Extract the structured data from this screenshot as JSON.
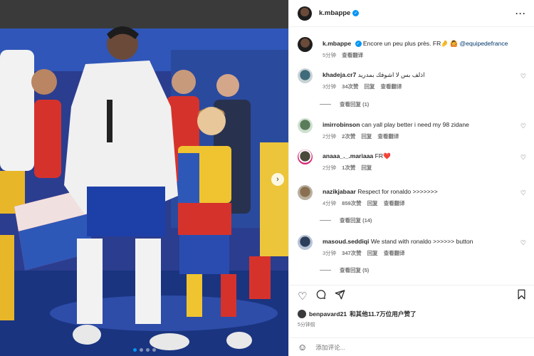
{
  "header": {
    "username": "k.mbappe",
    "more_icon": "more-horizontal-icon"
  },
  "caption": {
    "username": "k.mbappe",
    "text": "Encore un peu plus près. FR🤌 🙆",
    "mention": "@equipedefrance",
    "time": "5分钟",
    "translate": "查看翻译"
  },
  "comments": [
    {
      "username": "khadeja.cr7",
      "text": "اذلف بس لا اشوفك بمدريد",
      "time": "3分钟",
      "likes": "34次赞",
      "reply": "回复",
      "translate": "查看翻译",
      "view_replies": "查看回复 (1)"
    },
    {
      "username": "imirrobinson",
      "text": "can yall play better i need my 98 zidane",
      "time": "2分钟",
      "likes": "2次赞",
      "reply": "回复",
      "translate": "查看翻译"
    },
    {
      "username": "anaaa_._.mariaaa",
      "text": "FR❤️",
      "time": "2分钟",
      "likes": "1次赞",
      "reply": "回复"
    },
    {
      "username": "nazikjabaar",
      "text": "Respect for ronaldo >>>>>>>",
      "time": "4分钟",
      "likes": "859次赞",
      "reply": "回复",
      "translate": "查看翻译",
      "view_replies": "查看回复 (14)"
    },
    {
      "username": "masoud.seddiqi",
      "text": "We stand with ronaldo >>>>>> button",
      "time": "3分钟",
      "likes": "347次赞",
      "reply": "回复",
      "translate": "查看翻译",
      "view_replies": "查看回复 (5)"
    }
  ],
  "likes": {
    "user": "benpavard21",
    "text": "和其他11.7万位用户赞了"
  },
  "post_time": "5分钟前",
  "comment_box": {
    "placeholder": "添加评论..."
  },
  "colors": {
    "verified": "#0095f6",
    "accent": "#0095f6",
    "link": "#00376b",
    "heart_red": "#ed4956"
  }
}
